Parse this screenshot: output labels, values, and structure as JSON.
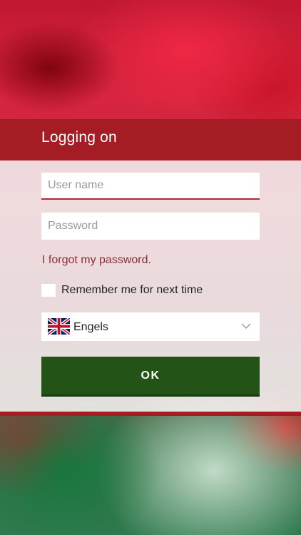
{
  "header": {
    "title": "Logging on"
  },
  "form": {
    "username_placeholder": "User name",
    "username_value": "",
    "password_placeholder": "Password",
    "password_value": "",
    "forgot_password_link": "I forgot my password.",
    "remember_me_label": "Remember me for next time",
    "remember_me_checked": false,
    "language": {
      "selected_label": "Engels",
      "flag_icon": "uk-flag-icon"
    },
    "submit_label": "OK"
  },
  "colors": {
    "header_red": "#a51c24",
    "link_red": "#8c2e36",
    "ok_green": "#235317"
  }
}
